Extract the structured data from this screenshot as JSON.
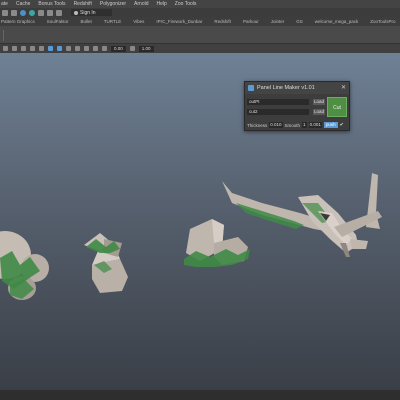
{
  "menubar": {
    "items": [
      "ate",
      "Cache",
      "Bonus Tools",
      "Redshift",
      "Polygonizer",
      "Arnold",
      "Help",
      "Zoo Tools"
    ]
  },
  "statusline": {
    "signin_label": "Sign In"
  },
  "shelf_tabs": [
    "Pattern Graphics",
    "SoulFaktor",
    "Bullet",
    "TURTLE",
    "Vibes",
    "IPrC_Firework_Dunbar",
    "Redshift",
    "Parkour",
    "Jointer",
    "GS",
    "welcome_mega_pack",
    "ZooToolsPro"
  ],
  "view_toolbar": {
    "field_a": "0.00",
    "field_b": "1.00"
  },
  "viewport": {
    "camera_label": "persp"
  },
  "panel": {
    "title": "Panel Line Maker v1.01",
    "field1_value": "outPt",
    "field2_value": "cut2",
    "load_label": "Load",
    "cut_label": "Cut",
    "thickness_label": "Thickness",
    "thickness_value": "0.010",
    "smooth_label": "Smooth",
    "smooth_value": "1",
    "offset_value": "0.001",
    "push_label": "push",
    "push_checked": "✔"
  },
  "colors": {
    "panel_accent": "#4f8f43",
    "push_button": "#5b9bd5",
    "geometry": "#bfb6ae",
    "panel_lines": "#3f8a45"
  }
}
